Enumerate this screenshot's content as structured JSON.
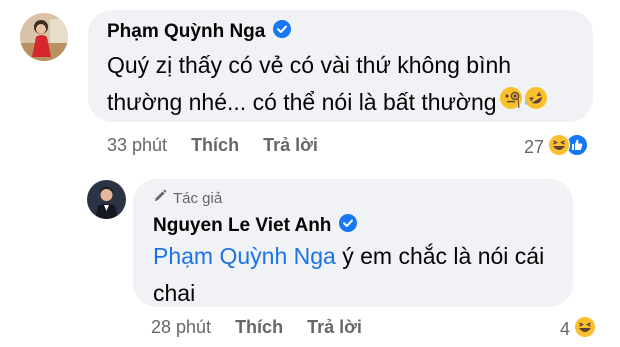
{
  "comments": [
    {
      "author": "Phạm Quỳnh Nga",
      "verified": true,
      "text_line1": "Quý zị thấy có vẻ có vài thứ không bình",
      "text_line2": "thường nhé... có thể nói là bất thường",
      "text_emojis": [
        "monocle-face",
        "rolling-laughing"
      ],
      "time": "33 phút",
      "like_label": "Thích",
      "reply_label": "Trả lời",
      "reaction_count": "27",
      "reactions": [
        "haha",
        "like"
      ]
    },
    {
      "author_badge": "Tác giả",
      "author": "Nguyen Le Viet Anh",
      "verified": true,
      "mention": "Phạm Quỳnh Nga",
      "text_line1_rest": " ý em chắc là nói cái",
      "text_line2": "chai",
      "time": "28 phút",
      "like_label": "Thích",
      "reply_label": "Trả lời",
      "reaction_count": "4",
      "reactions": [
        "haha"
      ]
    }
  ],
  "colors": {
    "bubble": "#f0f2f5",
    "verified": "#1877f2",
    "mention": "#1b74e4",
    "meta": "#65676b"
  }
}
